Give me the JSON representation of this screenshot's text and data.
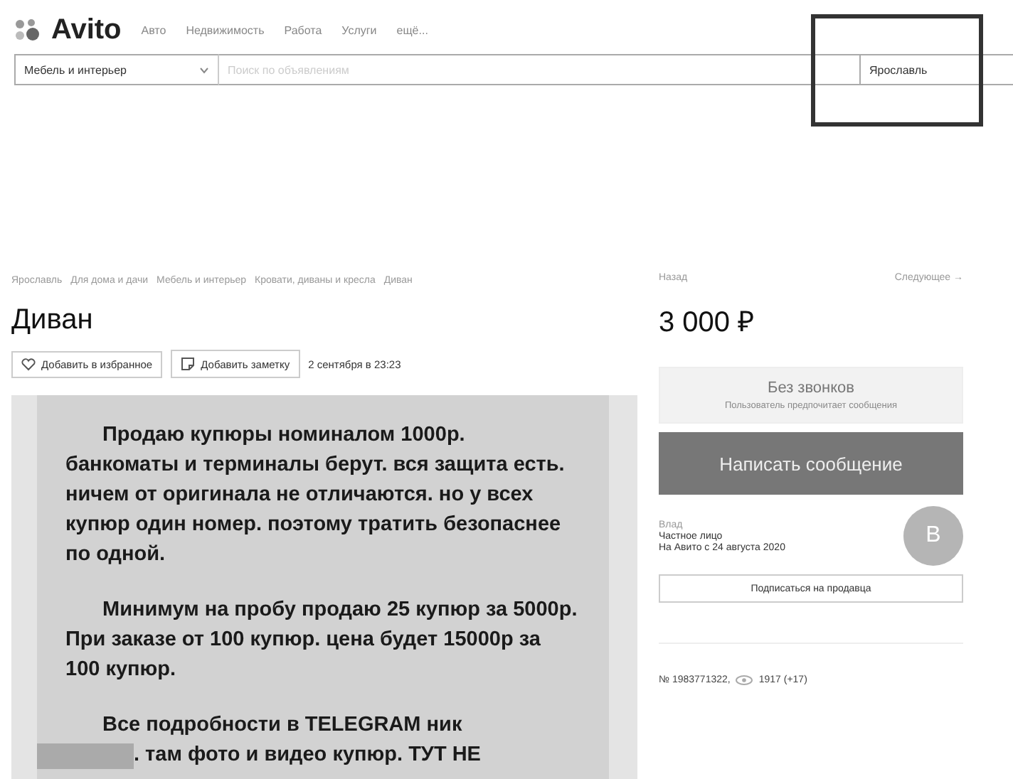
{
  "header": {
    "logo": "Avito",
    "nav": [
      "Авто",
      "Недвижимость",
      "Работа",
      "Услуги",
      "ещё..."
    ]
  },
  "search": {
    "category": "Мебель и интерьер",
    "placeholder": "Поиск по объявлениям",
    "city": "Ярославль"
  },
  "breadcrumbs": [
    "Ярославль",
    "Для дома и дачи",
    "Мебель и интерьер",
    "Кровати, диваны и кресла",
    "Диван"
  ],
  "listing": {
    "title": "Диван",
    "actions": [
      "Добавить в избранное",
      "Добавить заметку"
    ],
    "date": "2 сентября в 23:23",
    "image_text": [
      {
        "kind": "para",
        "text": "Продаю купюры номиналом 1000р. банкоматы и терминалы берут. вся защита есть. ничем от оригинала не отличаются. но у всех купюр один номер. поэтому тратить безопаснее по одной."
      },
      {
        "kind": "para",
        "text": "Минимум на пробу продаю 25 купюр за 5000р. При заказе от 100 купюр. цена будет 15000р за 100 купюр."
      },
      {
        "kind": "redacted",
        "text": "Все подробности в TELEGRAM ник",
        "after": ". там фото и видео купюр. ТУТ НЕ"
      }
    ]
  },
  "nav": {
    "back": "Назад",
    "next": "Следующее →"
  },
  "price": "3 000 ₽",
  "contact": {
    "title": "Без звонков",
    "subtitle": "Пользователь предпочитает сообщения",
    "button": "Написать сообщение"
  },
  "seller": {
    "name": "Влад",
    "type": "Частное лицо",
    "since": "На Авито с 24 августа 2020",
    "avatar": "В",
    "subscribe": "Подписаться на продавца"
  },
  "stats": {
    "number": "№ 1983771322,",
    "views": "1917 (+17)"
  }
}
